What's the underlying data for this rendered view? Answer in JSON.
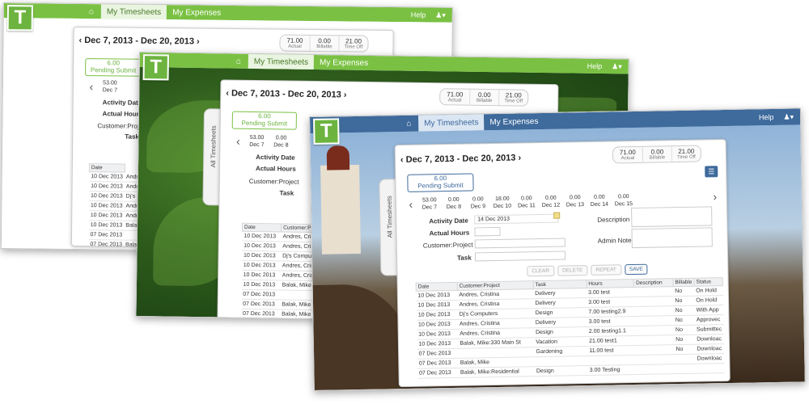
{
  "nav": {
    "logo": "T",
    "tabs": [
      "My Timesheets",
      "My Expenses"
    ],
    "help": "Help",
    "user_glyph": "♟▾"
  },
  "header": {
    "date_range": "Dec 7, 2013 - Dec 20, 2013",
    "stats": [
      {
        "value": "71.00",
        "label": "Actual"
      },
      {
        "value": "0.00",
        "label": "Billable"
      },
      {
        "value": "21.00",
        "label": "Time Off"
      }
    ],
    "pending_hours": "6.00",
    "pending_label": "Pending Submit",
    "side_tab": "All Timesheets"
  },
  "days": [
    {
      "hours": "53.00",
      "date": "Dec 7"
    },
    {
      "hours": "0.00",
      "date": "Dec 8"
    },
    {
      "hours": "0.00",
      "date": "Dec 9"
    },
    {
      "hours": "18.00",
      "date": "Dec 10"
    },
    {
      "hours": "0.00",
      "date": "Dec 11"
    },
    {
      "hours": "0.00",
      "date": "Dec 12"
    },
    {
      "hours": "0.00",
      "date": "Dec 13"
    },
    {
      "hours": "0.00",
      "date": "Dec 14"
    },
    {
      "hours": "0.00",
      "date": "Dec 15"
    }
  ],
  "form": {
    "activity_date_label": "Activity Date",
    "activity_date_value": "14 Dec 2013",
    "actual_hours_label": "Actual Hours",
    "customer_project_label": "Customer:Project",
    "task_label": "Task",
    "description_label": "Description",
    "admin_notes_label": "Admin Notes",
    "buttons": {
      "clear": "CLEAR",
      "delete": "DELETE",
      "repeat": "REPEAT",
      "save": "SAVE"
    }
  },
  "table": {
    "headers": [
      "Date",
      "Customer:Project",
      "Task",
      "Hours",
      "Description",
      "Billable",
      "Status"
    ],
    "rows": [
      [
        "10 Dec 2013",
        "Andres, Cristina",
        "Delivery",
        "3.00 test",
        "",
        "No",
        "On Hold"
      ],
      [
        "10 Dec 2013",
        "Andres, Cristina",
        "Delivery",
        "3.00 test",
        "",
        "No",
        "On Hold"
      ],
      [
        "10 Dec 2013",
        "Dj's Computers",
        "Design",
        "7.00 testing2.9",
        "",
        "No",
        "With App"
      ],
      [
        "10 Dec 2013",
        "Andres, Cristina",
        "Delivery",
        "3.00 test",
        "",
        "No",
        "Approvec"
      ],
      [
        "10 Dec 2013",
        "Andres, Cristina",
        "Design",
        "2.00 testing1.1",
        "",
        "No",
        "Submittec"
      ],
      [
        "10 Dec 2013",
        "Balak, Mike:330 Main St",
        "Vacation",
        "21.00 test1",
        "",
        "No",
        "Downloac"
      ],
      [
        "07 Dec 2013",
        "",
        "Gardening",
        "11.00 test",
        "",
        "No",
        "Downloac"
      ],
      [
        "07 Dec 2013",
        "Balak, Mike",
        "",
        "",
        "",
        "",
        "Downloac"
      ],
      [
        "07 Dec 2013",
        "Balak, Mike:Residential",
        "Design",
        "3.00 Testing",
        "",
        "",
        ""
      ]
    ],
    "short_rows_1": [
      [
        "10 Dec 2013",
        "Andres, Cr"
      ],
      [
        "10 Dec 2013",
        "Andres, Cr"
      ],
      [
        "10 Dec 2013",
        "Dj's Com"
      ],
      [
        "10 Dec 2013",
        "Andres, C"
      ],
      [
        "10 Dec 2013",
        "Andres, C"
      ],
      [
        "10 Dec 2013",
        "Balak, M"
      ],
      [
        "07 Dec 2013",
        ""
      ],
      [
        "07 Dec 2013",
        "Balak, M"
      ],
      [
        "07 Dec 2013",
        "Balak, M"
      ]
    ],
    "short_rows_2": [
      [
        "10 Dec 2013",
        "Andres, Cris"
      ],
      [
        "10 Dec 2013",
        "Andres, Cris"
      ],
      [
        "10 Dec 2013",
        "Dj's Computers"
      ],
      [
        "10 Dec 2013",
        "Andres, Cris"
      ],
      [
        "10 Dec 2013",
        "Andres, Cris"
      ],
      [
        "10 Dec 2013",
        "Balak, Mike"
      ],
      [
        "07 Dec 2013",
        ""
      ],
      [
        "07 Dec 2013",
        "Balak, Mike"
      ],
      [
        "07 Dec 2013",
        "Balak, Mike"
      ]
    ]
  },
  "colors": {
    "green_bar": "#7ac143",
    "blue_bar": "#3e6a9c",
    "pending_green": "#6cb43f",
    "pending_blue": "#3e6a9c"
  }
}
